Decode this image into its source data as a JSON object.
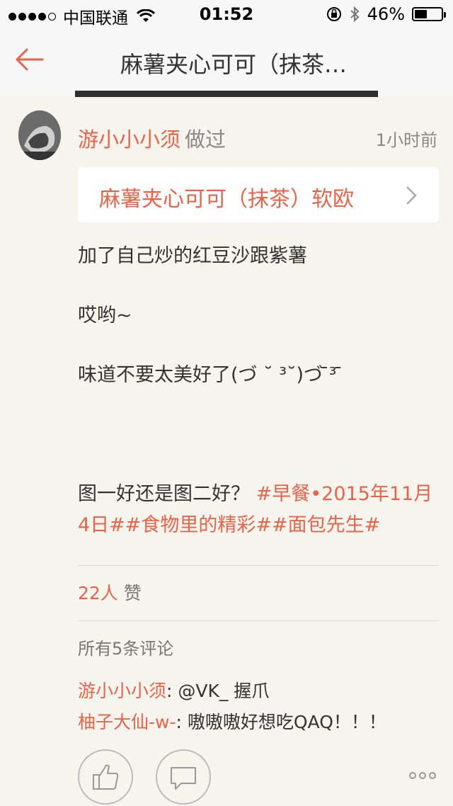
{
  "status_bar": {
    "carrier": "中国联通",
    "time": "01:52",
    "battery_text": "46%",
    "battery_level": 0.46
  },
  "nav": {
    "title": "麻薯夹心可可（抹茶…"
  },
  "post": {
    "author": "游小小小须",
    "verb": "做过",
    "time": "1小时前",
    "recipe_name": "麻薯夹心可可（抹茶）软欧",
    "lines": [
      "加了自己炒的红豆沙跟紫薯",
      "哎哟~",
      "味道不要太美好了(づ ˘ ³˘)づ ̄³ ̄"
    ],
    "question": "图一好还是图二好？",
    "tags_line1": "#早餐•2015年11月",
    "tags_line2": "4日##食物里的精彩##面包先生#"
  },
  "likes": {
    "count": "22人",
    "label": "赞"
  },
  "comments": {
    "header": "所有5条评论",
    "items": [
      {
        "user": "游小小小须",
        "text": ": @VK_   握爪"
      },
      {
        "user": "柚子大仙-w-",
        "text": ": 嗷嗷嗷好想吃QAQ！！！"
      }
    ]
  },
  "colors": {
    "accent": "#e8634a",
    "background": "#f5f4ed",
    "navbar": "#f7f7f7"
  },
  "icons": {
    "back": "arrow-left-icon",
    "chevron": "chevron-right-icon",
    "like": "thumbs-up-icon",
    "comment": "comment-bubble-icon",
    "more": "more-dots-icon"
  }
}
